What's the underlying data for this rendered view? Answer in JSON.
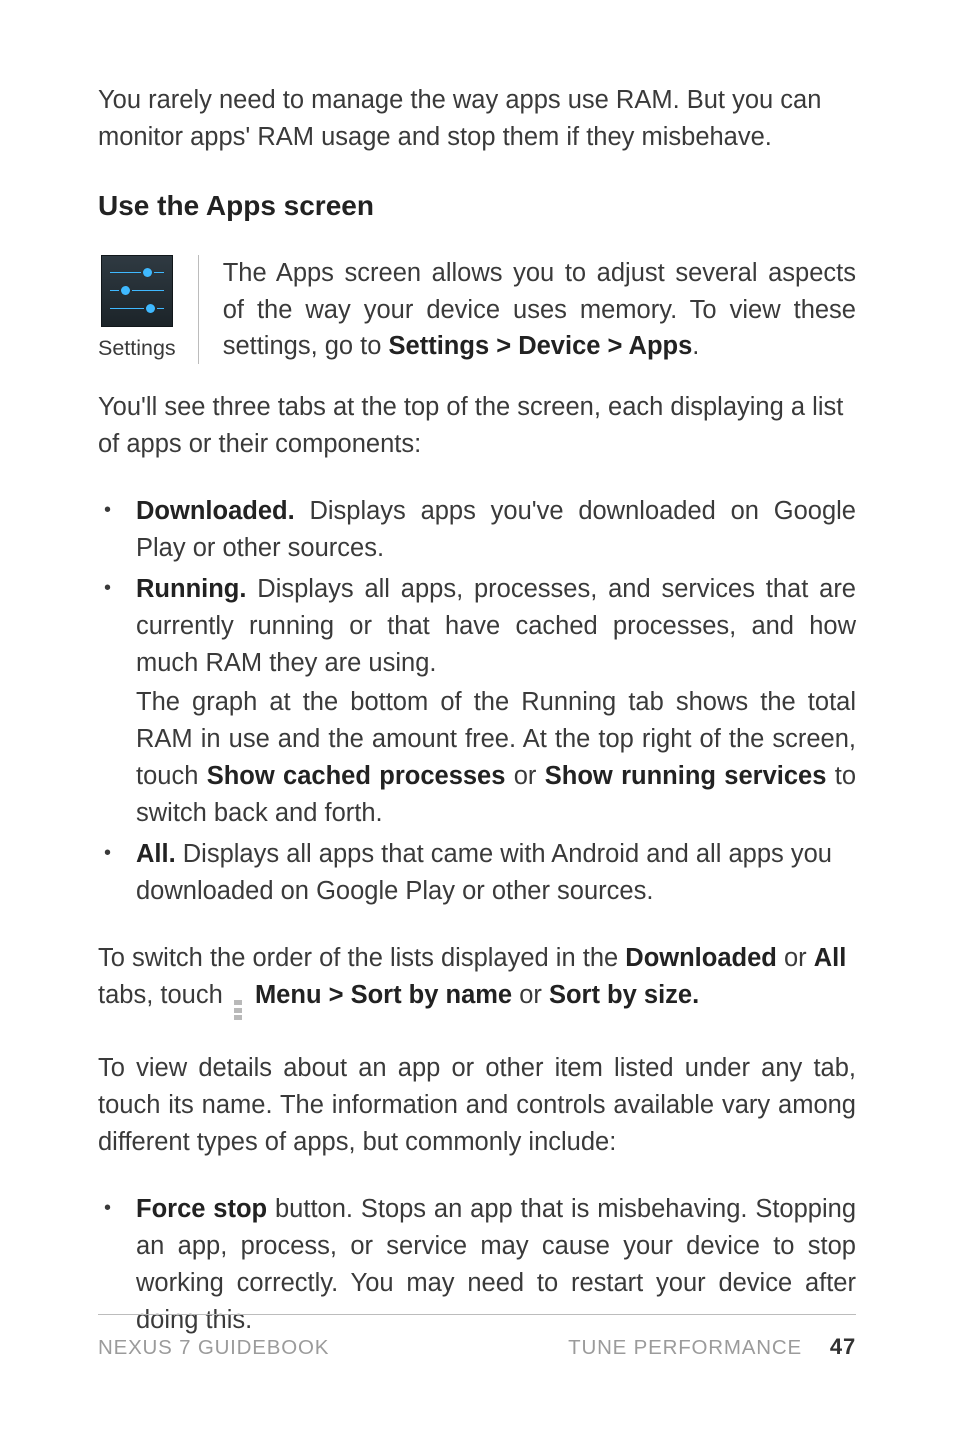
{
  "intro_para": "You rarely need to manage the way apps use RAM. But you can monitor apps' RAM usage and stop them if they misbehave.",
  "heading": "Use the Apps screen",
  "icon_caption": "Settings",
  "icon_para_pre": "The Apps screen allows you to adjust several aspects of the way your device uses memory. To view these settings, go to ",
  "icon_para_bold": "Settings > Device > Apps",
  "icon_para_post": ".",
  "tabs_intro": "You'll see three tabs at the top of the screen, each displaying a list of apps or their components:",
  "bullet1_label": "Downloaded.",
  "bullet1_text": " Displays apps you've downloaded on Google Play or other sources.",
  "bullet2_label": "Running.",
  "bullet2_text": " Displays all apps, processes, and services that are currently running or that have cached processes, and how much RAM they are using.",
  "bullet2_sub_pre": "The graph at the bottom of the Running tab shows the total RAM in use and the amount free. At the top right of the screen, touch ",
  "bullet2_sub_b1": "Show cached processes",
  "bullet2_sub_mid": " or ",
  "bullet2_sub_b2": "Show running services",
  "bullet2_sub_post": " to switch back and forth.",
  "bullet3_label": "All.",
  "bullet3_text": " Displays all apps that came with Android and all apps you downloaded on Google Play or other sources.",
  "switch_pre": "To switch the order of the lists displayed in the ",
  "switch_b1": "Downloaded",
  "switch_mid1": " or ",
  "switch_b2": "All",
  "switch_mid2": " tabs, touch ",
  "switch_b3": "Menu > Sort by name",
  "switch_mid3": " or ",
  "switch_b4": "Sort by size.",
  "view_details": "To view details about an app or other item listed under any tab, touch its name. The information and controls available vary among different types of apps, but commonly include:",
  "bullet4_label": "Force stop",
  "bullet4_text": " button. Stops an app that is misbehaving. Stopping an app, process, or service may cause your device to stop working correctly. You may need to restart your device after doing this.",
  "footer_left": "NEXUS 7 GUIDEBOOK",
  "footer_center": "TUNE PERFORMANCE",
  "footer_page": "47"
}
